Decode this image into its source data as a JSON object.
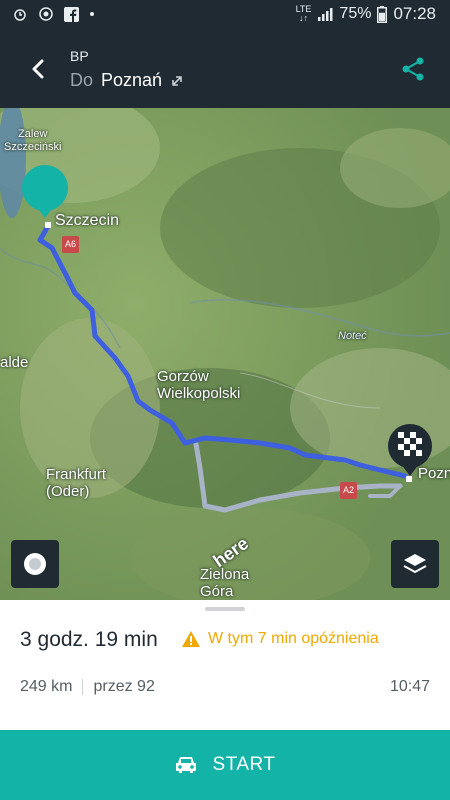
{
  "status_bar": {
    "lte_label_top": "LTE",
    "lte_label_bottom": "↓↑",
    "battery_pct": "75%",
    "time": "07:28",
    "battery_level": 0.75,
    "icons": [
      "alarm-icon",
      "screen-record-icon",
      "facebook-icon",
      "dot-icon",
      "signal-icon",
      "battery-icon"
    ]
  },
  "header": {
    "route_code": "BP",
    "to_prefix": "Do",
    "destination": "Poznań",
    "back_icon": "back-arrow-icon",
    "expand_icon": "expand-icon",
    "share_icon": "share-icon",
    "accent_color": "#14b3a7"
  },
  "map": {
    "labels": {
      "zalew": "Zalew\nSzczeciński",
      "szczecin": "Szczecin",
      "a6": "A6",
      "gorzow": "Gorzów\nWielkopolski",
      "notec": "Noteć",
      "alde": "alde",
      "frankfurt": "Frankfurt\n(Oder)",
      "a2": "A2",
      "poznan": "Pozn",
      "zielona": "Zielona\nGóra",
      "watermark": "here"
    },
    "route_color": "#3d5fe0",
    "alt_route_color": "#a9b3c8",
    "location_button_icon": "location-target-icon",
    "layers_button_icon": "layers-icon"
  },
  "route": {
    "duration": "3 godz. 19 min",
    "delay_text": "W tym 7 min opóźnienia",
    "distance": "249 km",
    "via": "przez 92",
    "eta": "10:47",
    "warning_color": "#f0a900"
  },
  "start": {
    "label": "START",
    "icon": "car-icon"
  }
}
